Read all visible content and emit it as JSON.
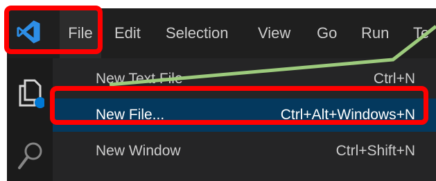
{
  "menubar": {
    "items": [
      {
        "label": "File"
      },
      {
        "label": "Edit"
      },
      {
        "label": "Selection"
      },
      {
        "label": "View"
      },
      {
        "label": "Go"
      },
      {
        "label": "Run"
      },
      {
        "label": "Te"
      }
    ]
  },
  "file_menu": {
    "items": [
      {
        "label": "New Text File",
        "shortcut": "Ctrl+N"
      },
      {
        "label": "New File...",
        "shortcut": "Ctrl+Alt+Windows+N"
      },
      {
        "label": "New Window",
        "shortcut": "Ctrl+Shift+N"
      }
    ],
    "selected_index": 1
  },
  "icons": {
    "app_logo": "vscode-logo-icon",
    "explorer": "explorer-files-icon",
    "search": "search-icon"
  },
  "colors": {
    "background": "#1f1f1f",
    "menu_background": "#252526",
    "selected_background": "#04395e",
    "text": "#cccccc",
    "annotation_red": "#ff0000",
    "annotation_line": "#9dcb7d",
    "logo_blue": "#2d8ee6"
  }
}
